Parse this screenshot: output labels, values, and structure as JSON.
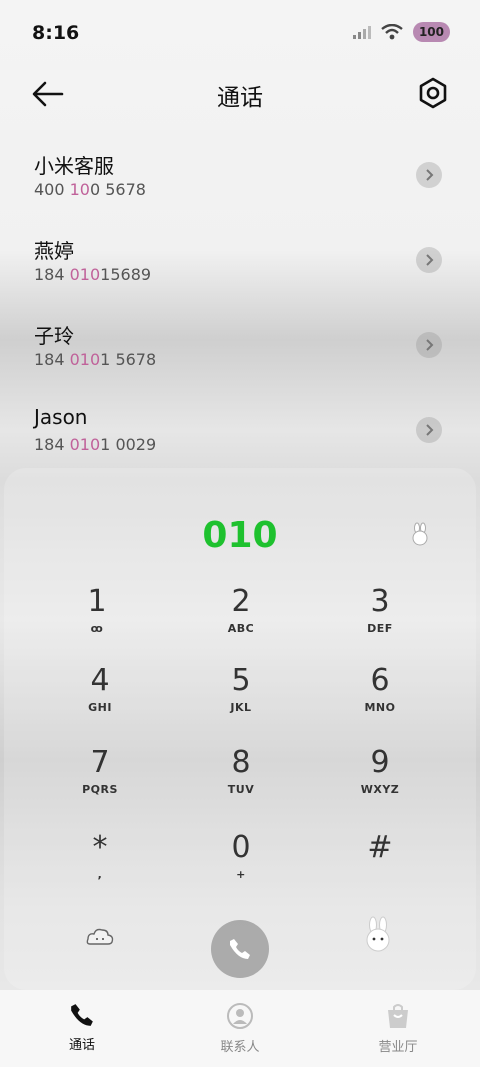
{
  "status_bar": {
    "time": "8:16",
    "battery": "100"
  },
  "header": {
    "title": "通话"
  },
  "contacts": [
    {
      "name": "小米客服",
      "num_a": "400 ",
      "num_hl": "10",
      "num_b": "0 5678"
    },
    {
      "name": "燕婷",
      "num_a": "184 ",
      "num_hl": "010",
      "num_b": "15689"
    },
    {
      "name": "子玲",
      "num_a": "184 ",
      "num_hl": "010",
      "num_b": "1 5678"
    },
    {
      "name": "Jason",
      "num_a": "184 ",
      "num_hl": "010",
      "num_b": "1 0029"
    }
  ],
  "dialpad": {
    "dialed_number": "010",
    "keys": [
      {
        "digit": "1",
        "letters": "ꝏ"
      },
      {
        "digit": "2",
        "letters": "ABC"
      },
      {
        "digit": "3",
        "letters": "DEF"
      },
      {
        "digit": "4",
        "letters": "GHI"
      },
      {
        "digit": "5",
        "letters": "JKL"
      },
      {
        "digit": "6",
        "letters": "MNO"
      },
      {
        "digit": "7",
        "letters": "PQRS"
      },
      {
        "digit": "8",
        "letters": "TUV"
      },
      {
        "digit": "9",
        "letters": "WXYZ"
      },
      {
        "digit": "*",
        "letters": ","
      },
      {
        "digit": "0",
        "letters": "+"
      },
      {
        "digit": "#",
        "letters": ""
      }
    ]
  },
  "bottom_nav": {
    "tabs": [
      {
        "label": "通话",
        "active": true
      },
      {
        "label": "联系人",
        "active": false
      },
      {
        "label": "营业厅",
        "active": false
      }
    ]
  },
  "colors": {
    "dialed": "#1ec12e",
    "highlight": "#c0629a",
    "battery": "#b889b2"
  },
  "icons": [
    "signal-icon",
    "wifi-icon",
    "back-arrow-icon",
    "gear-icon",
    "chevron-right-icon",
    "bunny-sticker-icon",
    "cloud-bunny-icon",
    "phone-icon",
    "contacts-icon",
    "shop-bag-icon"
  ]
}
